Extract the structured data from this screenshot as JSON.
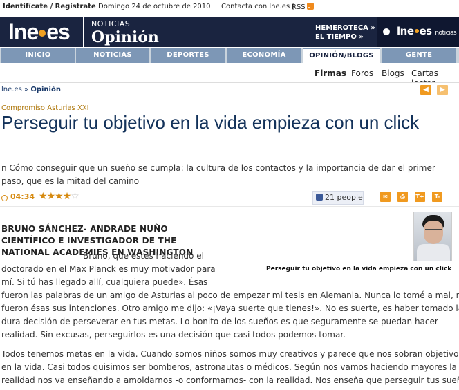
{
  "util": {
    "login": "Identifícate / Regístrate",
    "date": "Domingo 24 de octubre de 2010",
    "contact": "Contacta con lne.es |",
    "rss": "RSS"
  },
  "header": {
    "logo": "lne.es",
    "section_small": "NOTICIAS",
    "section_big": "Opinión",
    "hemeroteca": "HEMEROTECA »",
    "eltiempo": "EL TIEMPO »",
    "ws_logo": "lne.es",
    "ws_small": "noticias"
  },
  "nav": [
    "INICIO",
    "NOTICIAS",
    "DEPORTES",
    "ECONOMÍA",
    "OPINIÓN/BLOGS",
    "GENTE"
  ],
  "subnav": [
    "Firmas",
    "Foros",
    "Blogs",
    "Cartas lector"
  ],
  "breadcrumb": {
    "home": "lne.es",
    "sep": "»",
    "section": "Opinión"
  },
  "article": {
    "kicker": "Compromiso Asturias XXI",
    "title": "Perseguir tu objetivo en la vida empieza con un click",
    "subtitle": "n Cómo conseguir que un sueño se cumpla: la cultura de los contactos y la importancia de dar el primer paso, que es la mitad del camino",
    "time": "04:34",
    "rating": 4,
    "rating_max": 5,
    "likes": "21 people",
    "tools": [
      "✉",
      "⎙",
      "T+",
      "T-"
    ],
    "photo_caption": "Perseguir tu objetivo en la vida empieza con un click",
    "byline": "BRUNO SÁNCHEZ- ANDRADE NUÑO CIENTÍFICO E INVESTIGADOR DE THE NATIONAL ACADEMIES EN WASHINGTON",
    "intro_first": "Bruno, que estés haciendo el",
    "intro_rest": [
      "doctorado en el Max Planck es muy motivador para",
      "mí. Si tú has llegado allí, cualquiera puede». Ésas"
    ],
    "para1_lines": [
      "fueron las palabras de un amigo de Asturias al poco de empezar mi tesis en Alemania. Nunca lo tomé a mal, ni",
      "fueron ésas sus intenciones. Otro amigo me dijo: «¡Vaya suerte que tienes!». No es suerte, es haber tomado la",
      "dura decisión de perseverar en tus metas. Lo bonito de los sueños es que seguramente se puedan hacer",
      "realidad. Sin excusas, perseguirlos es una decisión que casi todos podemos tomar."
    ],
    "para2_lines": [
      "Todos tenemos metas en la vida. Cuando somos niños somos muy creativos y parece que nos sobran objetivos",
      "en la vida. Casi todos quisimos ser bomberos, astronautas o médicos. Según nos vamos haciendo mayores la",
      "realidad nos va enseñando a amoldarnos -o conformarnos- con la realidad. Nos enseña que perseguir tus sueños"
    ]
  }
}
